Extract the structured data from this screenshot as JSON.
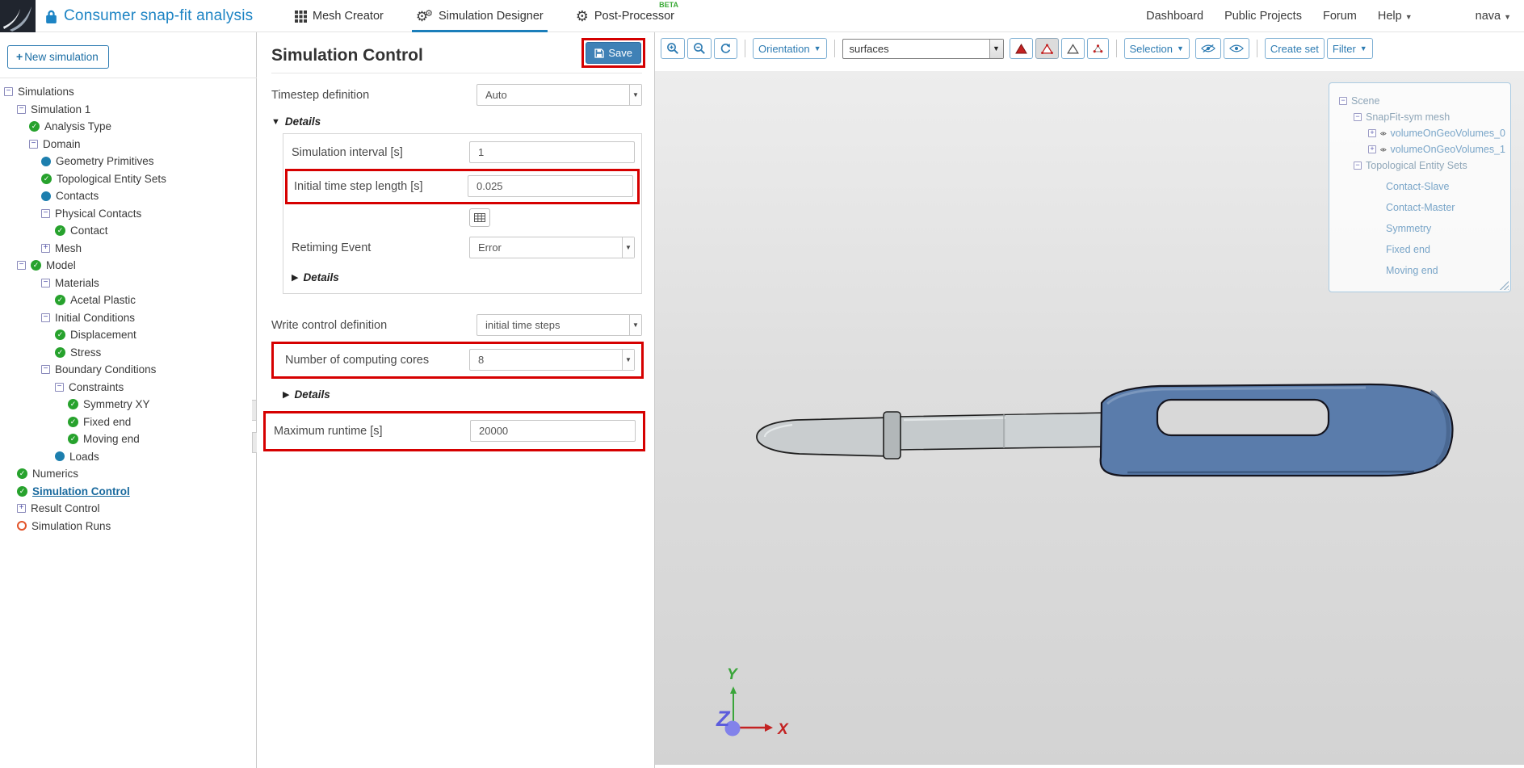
{
  "topbar": {
    "project_title": "Consumer snap-fit analysis",
    "tabs": [
      {
        "label": "Mesh Creator",
        "icon": "grid-icon",
        "active": false
      },
      {
        "label": "Simulation Designer",
        "icon": "gears-icon",
        "active": true
      },
      {
        "label": "Post-Processor",
        "icon": "gear-icon",
        "active": false,
        "badge": "BETA"
      }
    ],
    "links": [
      {
        "label": "Dashboard"
      },
      {
        "label": "Public Projects"
      },
      {
        "label": "Forum"
      }
    ],
    "help": {
      "label": "Help"
    },
    "user": {
      "label": "nava"
    }
  },
  "sidebar": {
    "new_simulation": {
      "label": "New simulation",
      "icon": "plus-icon"
    },
    "tree": [
      {
        "label": "Simulations",
        "icon": "collapse-minus"
      },
      {
        "label": "Simulation 1",
        "icon": "collapse-minus"
      },
      {
        "label": "Analysis Type",
        "icon": "check-circle"
      },
      {
        "label": "Domain",
        "icon": "collapse-minus"
      },
      {
        "label": "Geometry Primitives",
        "icon": "blue-dot"
      },
      {
        "label": "Topological Entity Sets",
        "icon": "check-circle"
      },
      {
        "label": "Contacts",
        "icon": "blue-dot"
      },
      {
        "label": "Physical Contacts",
        "icon": "collapse-minus"
      },
      {
        "label": "Contact",
        "icon": "check-circle"
      },
      {
        "label": "Mesh",
        "icon": "expand-plus"
      },
      {
        "label": "Model",
        "icon": "collapse-minus,check-circle"
      },
      {
        "label": "Materials",
        "icon": "collapse-minus"
      },
      {
        "label": "Acetal Plastic",
        "icon": "check-circle"
      },
      {
        "label": "Initial Conditions",
        "icon": "collapse-minus"
      },
      {
        "label": "Displacement",
        "icon": "check-circle"
      },
      {
        "label": "Stress",
        "icon": "check-circle"
      },
      {
        "label": "Boundary Conditions",
        "icon": "collapse-minus"
      },
      {
        "label": "Constraints",
        "icon": "collapse-minus"
      },
      {
        "label": "Symmetry XY",
        "icon": "check-circle"
      },
      {
        "label": "Fixed end",
        "icon": "check-circle"
      },
      {
        "label": "Moving end",
        "icon": "check-circle"
      },
      {
        "label": "Loads",
        "icon": "blue-dot"
      },
      {
        "label": "Numerics",
        "icon": "check-circle"
      },
      {
        "label": "Simulation Control",
        "icon": "check-circle",
        "selected": true
      },
      {
        "label": "Result Control",
        "icon": "expand-plus"
      },
      {
        "label": "Simulation Runs",
        "icon": "orange-ring"
      }
    ]
  },
  "panel": {
    "title": "Simulation Control",
    "save": {
      "label": "Save",
      "icon": "floppy-icon"
    },
    "timestep": {
      "label": "Timestep definition",
      "value": "Auto"
    },
    "details_top": {
      "label": "Details"
    },
    "sim_interval": {
      "label": "Simulation interval [s]",
      "value": "1"
    },
    "init_step": {
      "label": "Initial time step length [s]",
      "value": "0.025"
    },
    "retiming": {
      "label": "Retiming Event",
      "value": "Error"
    },
    "details_inner": {
      "label": "Details"
    },
    "write_control": {
      "label": "Write control definition",
      "value": "initial time steps"
    },
    "cores": {
      "label": "Number of computing cores",
      "value": "8"
    },
    "details_bottom": {
      "label": "Details"
    },
    "max_runtime": {
      "label": "Maximum runtime [s]",
      "value": "20000"
    }
  },
  "viewport": {
    "toolbar": {
      "orientation": {
        "label": "Orientation"
      },
      "surfaces": {
        "value": "surfaces"
      },
      "selection": {
        "label": "Selection"
      },
      "create_set": {
        "label": "Create set"
      },
      "filter": {
        "label": "Filter"
      }
    },
    "scene_tree": {
      "items": [
        {
          "label": "Scene",
          "icon": "collapse-minus"
        },
        {
          "label": "SnapFit-sym mesh",
          "icon": "collapse-minus"
        },
        {
          "label": "volumeOnGeoVolumes_0",
          "icon": "expand-plus,eye-icon"
        },
        {
          "label": "volumeOnGeoVolumes_1",
          "icon": "expand-plus,eye-icon"
        },
        {
          "label": "Topological Entity Sets",
          "icon": "collapse-minus"
        },
        {
          "label": "Contact-Slave"
        },
        {
          "label": "Contact-Master"
        },
        {
          "label": "Symmetry"
        },
        {
          "label": "Fixed end"
        },
        {
          "label": "Moving end"
        }
      ]
    },
    "axis": {
      "x": "X",
      "y": "Y",
      "z": "Z"
    }
  },
  "colors": {
    "accent_blue": "#1d84c4",
    "save_button": "#3f81b6",
    "highlight_red": "#d40000",
    "check_green": "#27a22d",
    "dot_blue": "#1d7fae",
    "ring_orange": "#e2542a",
    "model_gray": "#c9cdcf",
    "model_blue": "#5a7cab"
  }
}
